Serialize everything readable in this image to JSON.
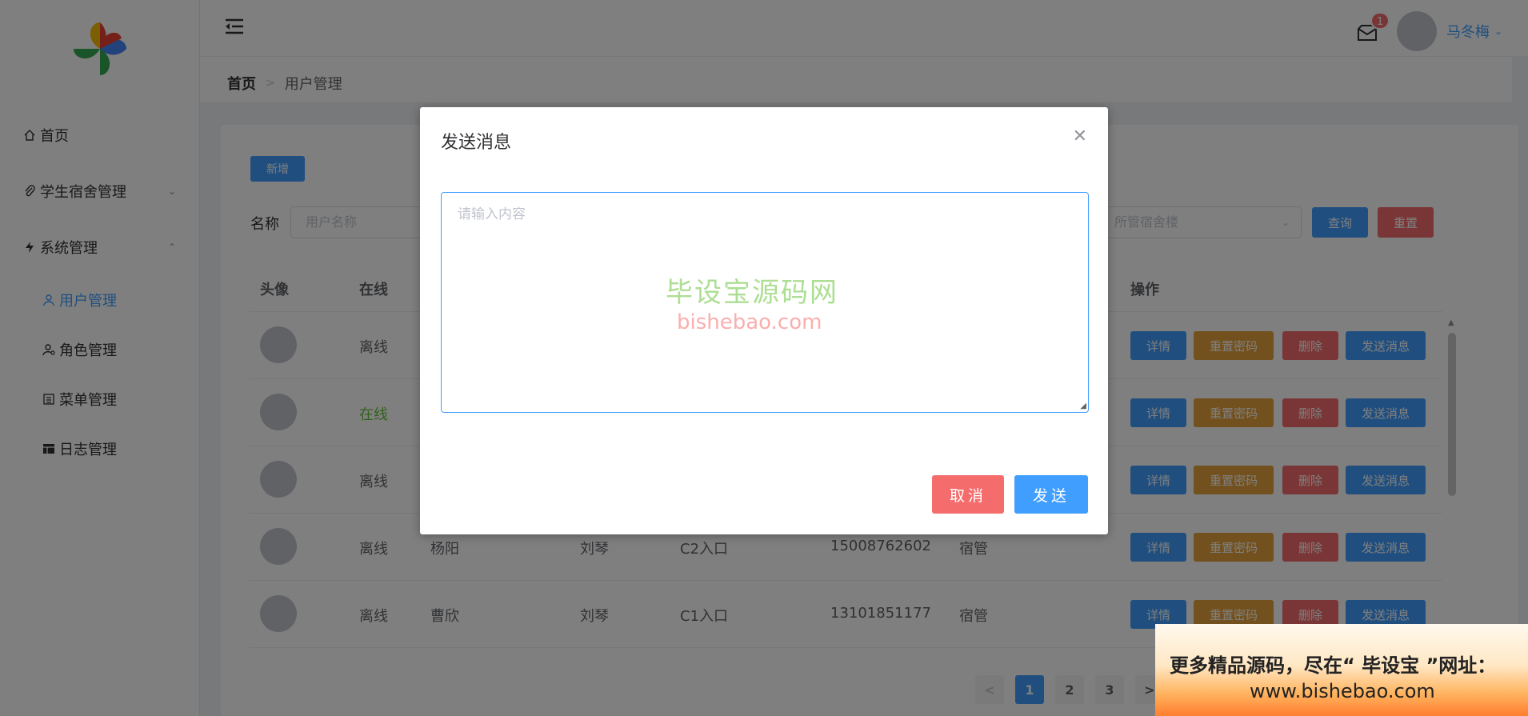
{
  "sidebar": {
    "items": [
      {
        "label": "首页",
        "icon": "home-icon"
      },
      {
        "label": "学生宿舍管理",
        "icon": "paperclip-icon"
      },
      {
        "label": "系统管理",
        "icon": "lightning-icon"
      }
    ],
    "sub_items": [
      {
        "label": "用户管理",
        "icon": "user-icon"
      },
      {
        "label": "角色管理",
        "icon": "user-settings-icon"
      },
      {
        "label": "菜单管理",
        "icon": "list-icon"
      },
      {
        "label": "日志管理",
        "icon": "table-icon"
      }
    ]
  },
  "header": {
    "badge_count": "1",
    "username": "马冬梅"
  },
  "breadcrumb": {
    "home": "首页",
    "current": "用户管理"
  },
  "toolbar": {
    "add_label": "新增",
    "name_label": "名称",
    "name_placeholder": "用户名称",
    "building_placeholder": "所管宿舍楼",
    "query_label": "查询",
    "reset_label": "重置"
  },
  "table": {
    "headers": {
      "avatar": "头像",
      "online": "在线",
      "ops": "操作"
    },
    "rows": [
      {
        "online": "离线",
        "name": "",
        "real": "",
        "building": "",
        "phone": "",
        "role": ""
      },
      {
        "online": "在线",
        "name": "",
        "real": "",
        "building": "",
        "phone": "",
        "role": ""
      },
      {
        "online": "离线",
        "name": "",
        "real": "",
        "building": "",
        "phone": "",
        "role": ""
      },
      {
        "online": "离线",
        "name": "杨阳",
        "real": "刘琴",
        "building": "C2入口",
        "phone": "15008762602",
        "role": "宿管"
      },
      {
        "online": "离线",
        "name": "曹欣",
        "real": "刘琴",
        "building": "C1入口",
        "phone": "13101851177",
        "role": "宿管"
      }
    ],
    "ops": {
      "detail": "详情",
      "reset_pwd": "重置密码",
      "delete": "删除",
      "send_msg": "发送消息"
    }
  },
  "pagination": {
    "pages": [
      "1",
      "2",
      "3"
    ],
    "active": "1"
  },
  "dialog": {
    "title": "发送消息",
    "textarea_placeholder": "请输入内容",
    "cancel_label": "取消",
    "send_label": "发送"
  },
  "watermark": {
    "line1": "毕设宝源码网",
    "line2": "bishebao.com"
  },
  "promo": {
    "line1": "更多精品源码，尽在“ 毕设宝 ”网址：",
    "line2": "www.bishebao.com"
  },
  "colors": {
    "primary": "#409eff",
    "danger": "#f56c6c",
    "warning": "#e6a23c",
    "success": "#67c23a"
  }
}
